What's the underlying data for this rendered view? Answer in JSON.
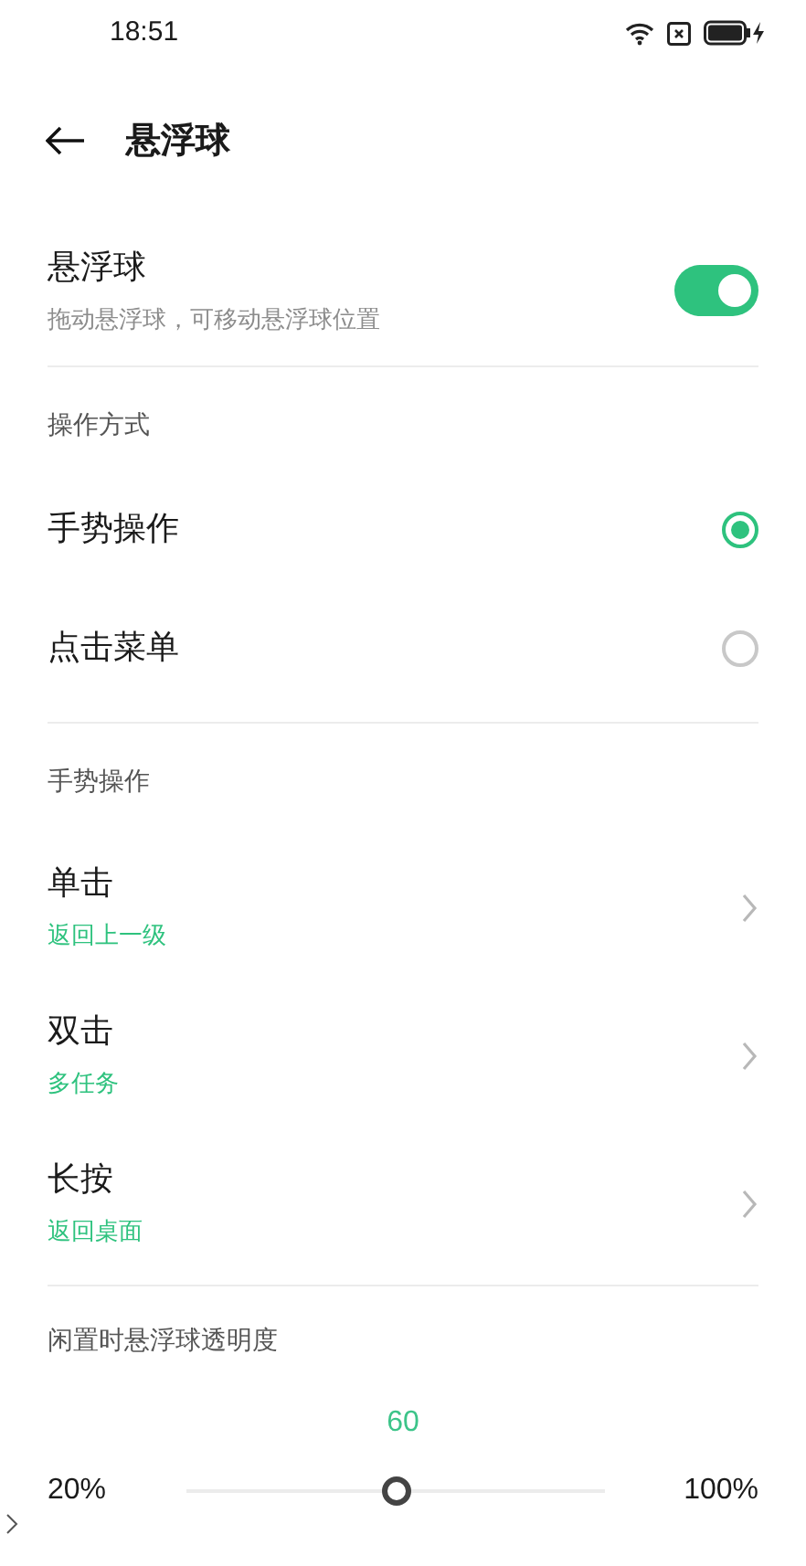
{
  "status_bar": {
    "time": "18:51"
  },
  "header": {
    "title": "悬浮球"
  },
  "master": {
    "title": "悬浮球",
    "subtitle": "拖动悬浮球，可移动悬浮球位置",
    "on": true
  },
  "mode_section": {
    "label": "操作方式",
    "options": [
      {
        "label": "手势操作",
        "selected": true
      },
      {
        "label": "点击菜单",
        "selected": false
      }
    ]
  },
  "gesture_section": {
    "label": "手势操作",
    "items": [
      {
        "title": "单击",
        "value": "返回上一级"
      },
      {
        "title": "双击",
        "value": "多任务"
      },
      {
        "title": "长按",
        "value": "返回桌面"
      }
    ]
  },
  "opacity_section": {
    "label": "闲置时悬浮球透明度",
    "reading": "60",
    "min_label": "20%",
    "max_label": "100%",
    "level": 0.5
  }
}
